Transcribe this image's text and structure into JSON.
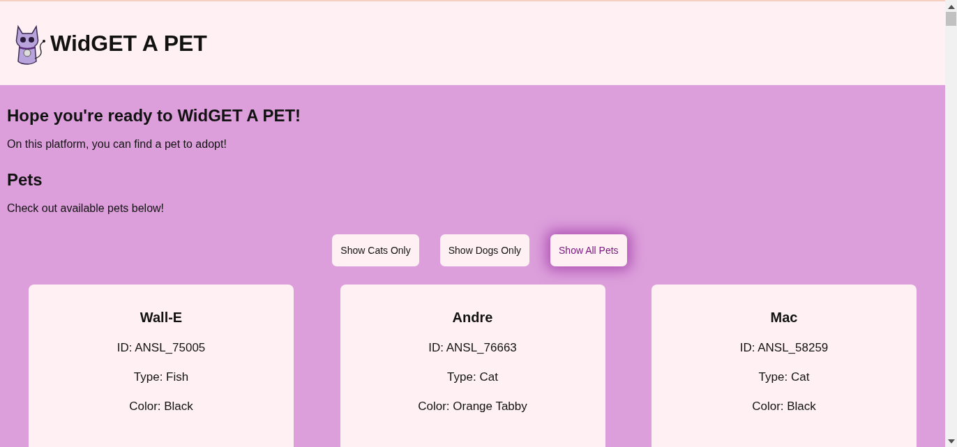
{
  "header": {
    "title": "WidGET A PET"
  },
  "intro": {
    "heading": "Hope you're ready to WidGET A PET!",
    "text": "On this platform, you can find a pet to adopt!"
  },
  "pets_section": {
    "heading": "Pets",
    "text": "Check out available pets below!"
  },
  "filters": [
    {
      "label": "Show Cats Only",
      "selected": false
    },
    {
      "label": "Show Dogs Only",
      "selected": false
    },
    {
      "label": "Show All Pets",
      "selected": true
    }
  ],
  "pets": [
    {
      "name": "Wall-E",
      "id": "ID: ANSL_75005",
      "type": "Type: Fish",
      "color_text": "Color: Black"
    },
    {
      "name": "Andre",
      "id": "ID: ANSL_76663",
      "type": "Type: Cat",
      "color_text": "Color: Orange Tabby"
    },
    {
      "name": "Mac",
      "id": "ID: ANSL_58259",
      "type": "Type: Cat",
      "color_text": "Color: Black"
    }
  ]
}
